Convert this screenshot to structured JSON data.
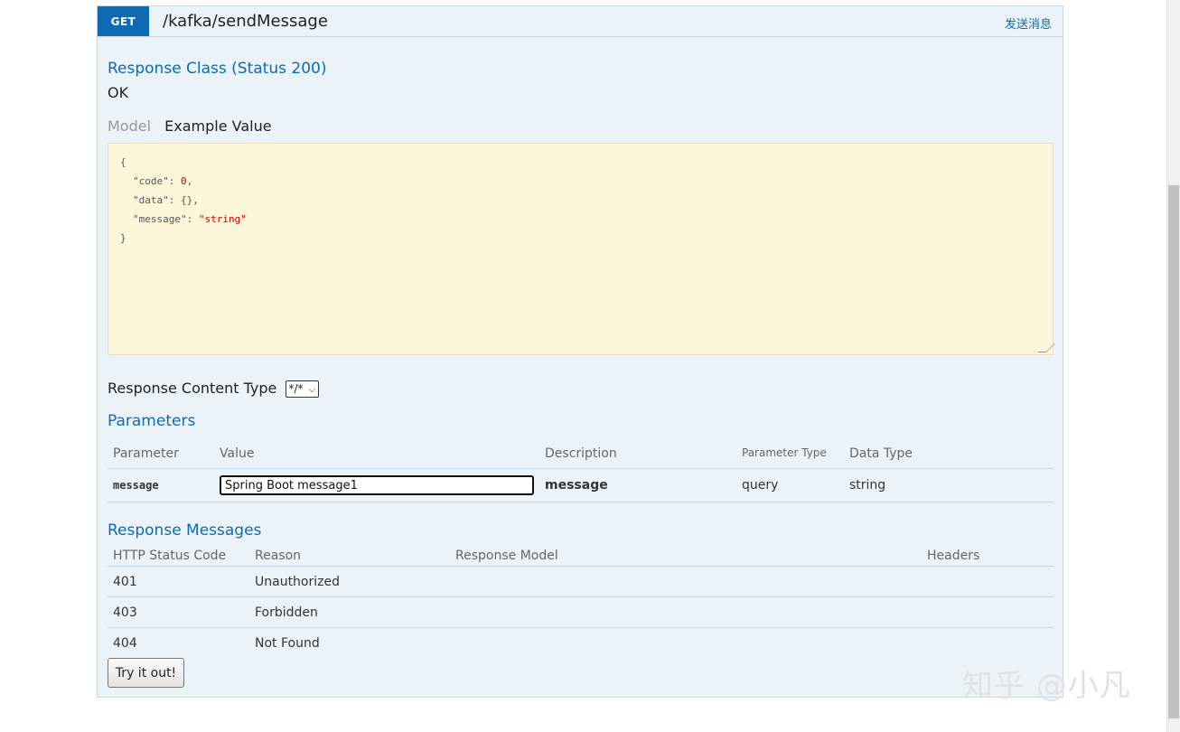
{
  "endpoint": {
    "method": "GET",
    "path": "/kafka/sendMessage",
    "header_link": "发送消息"
  },
  "response_class": {
    "title": "Response Class (Status 200)",
    "status_text": "OK"
  },
  "signature_tabs": {
    "model": "Model",
    "example": "Example Value"
  },
  "example_json": {
    "open": "{",
    "close": "}",
    "lines": [
      {
        "key": "\"code\"",
        "sep": ": ",
        "value": "0",
        "suffix": ","
      },
      {
        "key": "\"data\"",
        "sep": ": ",
        "value": "{}",
        "suffix": ","
      },
      {
        "key": "\"message\"",
        "sep": ": ",
        "value": "\"string\"",
        "suffix": ""
      }
    ]
  },
  "content_type": {
    "label": "Response Content Type",
    "selected": "*/*"
  },
  "parameters": {
    "title": "Parameters",
    "headers": [
      "Parameter",
      "Value",
      "Description",
      "Parameter Type",
      "Data Type"
    ],
    "rows": [
      {
        "parameter": "message",
        "value": "Spring Boot message1",
        "description": "message",
        "param_type": "query",
        "data_type": "string"
      }
    ]
  },
  "response_messages": {
    "title": "Response Messages",
    "headers": [
      "HTTP Status Code",
      "Reason",
      "Response Model",
      "Headers"
    ],
    "rows": [
      {
        "code": "401",
        "reason": "Unauthorized",
        "model": "",
        "headers": ""
      },
      {
        "code": "403",
        "reason": "Forbidden",
        "model": "",
        "headers": ""
      },
      {
        "code": "404",
        "reason": "Not Found",
        "model": "",
        "headers": ""
      }
    ]
  },
  "try_button": "Try it out!",
  "watermark": "知乎 @小凡",
  "colors": {
    "method_bg": "#0f6ab4",
    "panel_bg": "#ebf3f9",
    "snippet_bg": "#fcf6db",
    "heading_text": "#0f6ab4"
  }
}
